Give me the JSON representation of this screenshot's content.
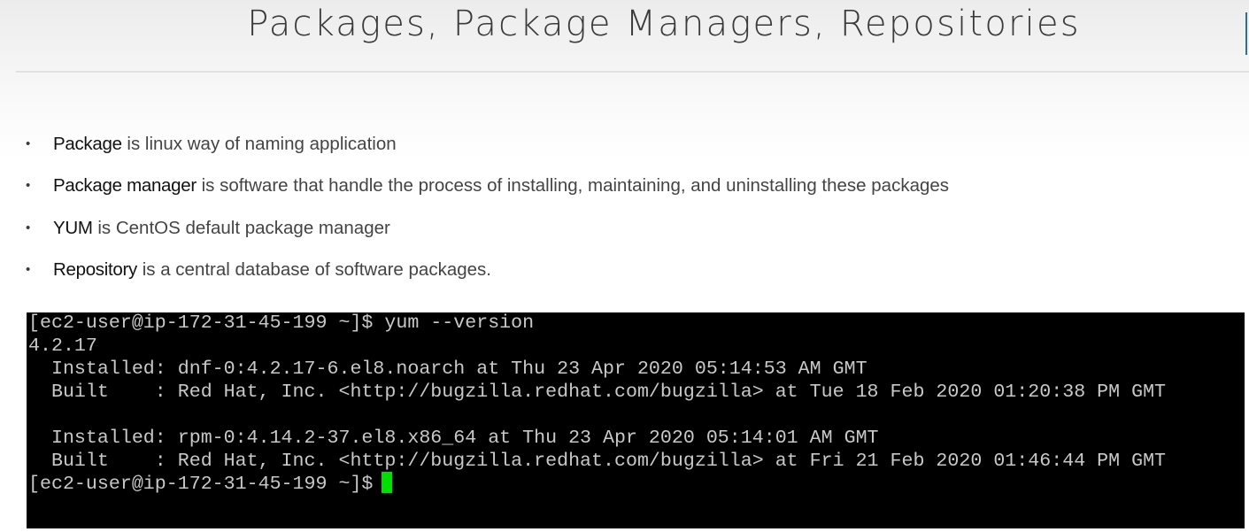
{
  "slide": {
    "title": "Packages, Package Managers, Repositories",
    "bullets": [
      {
        "term": "Package",
        "rest": " is linux way of naming application"
      },
      {
        "term": "Package manager",
        "rest": " is software that handle the process of installing, maintaining, and uninstalling these packages"
      },
      {
        "term": "YUM",
        "rest": " is CentOS default package manager"
      },
      {
        "term": "Repository",
        "rest": " is a central database of software packages."
      }
    ],
    "bullet_glyph": "•"
  },
  "terminal": {
    "lines": [
      "[ec2-user@ip-172-31-45-199 ~]$ yum --version",
      "4.2.17",
      "  Installed: dnf-0:4.2.17-6.el8.noarch at Thu 23 Apr 2020 05:14:53 AM GMT",
      "  Built    : Red Hat, Inc. <http://bugzilla.redhat.com/bugzilla> at Tue 18 Feb 2020 01:20:38 PM GMT",
      "",
      "  Installed: rpm-0:4.14.2-37.el8.x86_64 at Thu 23 Apr 2020 05:14:01 AM GMT",
      "  Built    : Red Hat, Inc. <http://bugzilla.redhat.com/bugzilla> at Fri 21 Feb 2020 01:46:44 PM GMT",
      "[ec2-user@ip-172-31-45-199 ~]$ "
    ],
    "background_color": "#000000",
    "text_color": "#c8c8c8",
    "cursor_color": "#00e000"
  }
}
